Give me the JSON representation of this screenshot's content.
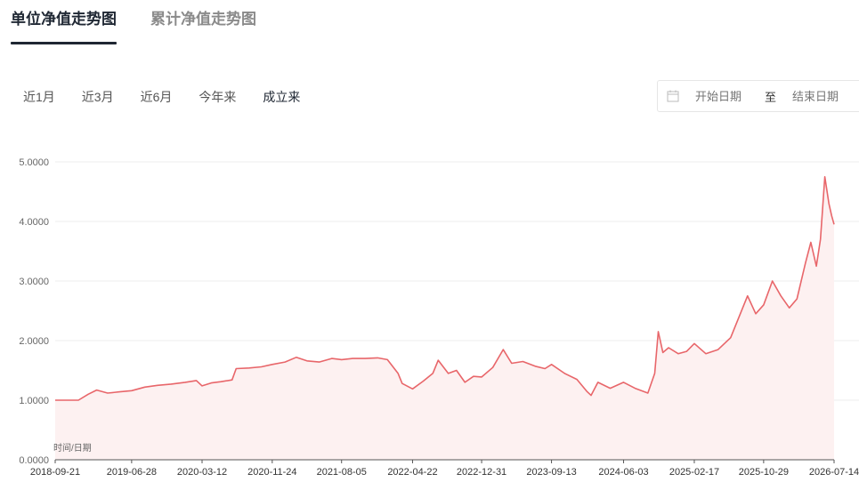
{
  "tabs": {
    "unit_nav": "单位净值走势图",
    "cumulative_nav": "累计净值走势图"
  },
  "ranges": [
    "近1月",
    "近3月",
    "近6月",
    "今年来",
    "成立来"
  ],
  "active_range_index": 4,
  "date_range": {
    "start_placeholder": "开始日期",
    "separator": "至",
    "end_placeholder": "结束日期"
  },
  "colors": {
    "line": "#e8666a",
    "area": "#fdf1f1",
    "tab_active": "#1f2733"
  },
  "chart_data": {
    "type": "area",
    "xlabel": "时间/日期",
    "ylabel": "",
    "ylim": [
      0,
      5
    ],
    "yticks": [
      "0.0000",
      "1.0000",
      "2.0000",
      "3.0000",
      "4.0000",
      "5.0000"
    ],
    "xticks": [
      "2018-09-21",
      "2019-06-28",
      "2020-03-12",
      "2020-11-24",
      "2021-08-05",
      "2022-04-22",
      "2022-12-31",
      "2023-09-13",
      "2024-06-03",
      "2025-02-17",
      "2025-10-29",
      "2026-07-14"
    ],
    "grid": true,
    "series": [
      {
        "name": "",
        "x": [
          "2018-09-21",
          "2018-12-15",
          "2019-01-20",
          "2019-02-20",
          "2019-04-01",
          "2019-05-15",
          "2019-06-28",
          "2019-08-15",
          "2019-10-01",
          "2019-11-20",
          "2020-01-10",
          "2020-02-20",
          "2020-03-12",
          "2020-04-15",
          "2020-05-20",
          "2020-06-30",
          "2020-07-15",
          "2020-08-31",
          "2020-10-15",
          "2020-11-24",
          "2021-01-10",
          "2021-02-20",
          "2021-03-31",
          "2021-05-15",
          "2021-06-30",
          "2021-08-05",
          "2021-09-15",
          "2021-10-31",
          "2021-12-15",
          "2022-01-20",
          "2022-02-28",
          "2022-03-15",
          "2022-04-22",
          "2022-05-31",
          "2022-07-05",
          "2022-07-25",
          "2022-08-31",
          "2022-09-30",
          "2022-10-31",
          "2022-12-01",
          "2022-12-31",
          "2023-02-10",
          "2023-03-20",
          "2023-04-20",
          "2023-05-31",
          "2023-07-15",
          "2023-08-20",
          "2023-09-13",
          "2023-10-31",
          "2023-12-15",
          "2024-01-20",
          "2024-02-05",
          "2024-03-01",
          "2024-04-15",
          "2024-06-03",
          "2024-07-15",
          "2024-08-31",
          "2024-09-25",
          "2024-10-08",
          "2024-10-25",
          "2024-11-15",
          "2024-12-20",
          "2025-01-20",
          "2025-02-17",
          "2025-03-31",
          "2025-05-15",
          "2025-06-30",
          "2025-07-31",
          "2025-08-31",
          "2025-09-30",
          "2025-10-29",
          "2025-11-30",
          "2025-12-31",
          "2026-01-31",
          "2026-02-28",
          "2026-03-31",
          "2026-04-20",
          "2026-05-10",
          "2026-05-25",
          "2026-06-10",
          "2026-06-25",
          "2026-07-05",
          "2026-07-14"
        ],
        "values": [
          1.0,
          1.0,
          1.1,
          1.17,
          1.12,
          1.14,
          1.16,
          1.22,
          1.25,
          1.27,
          1.3,
          1.33,
          1.24,
          1.29,
          1.31,
          1.34,
          1.53,
          1.54,
          1.56,
          1.6,
          1.64,
          1.72,
          1.66,
          1.64,
          1.7,
          1.68,
          1.7,
          1.7,
          1.71,
          1.68,
          1.45,
          1.28,
          1.19,
          1.32,
          1.45,
          1.67,
          1.45,
          1.5,
          1.3,
          1.4,
          1.39,
          1.55,
          1.85,
          1.62,
          1.65,
          1.57,
          1.53,
          1.6,
          1.45,
          1.35,
          1.15,
          1.08,
          1.3,
          1.2,
          1.3,
          1.2,
          1.12,
          1.45,
          2.15,
          1.8,
          1.88,
          1.78,
          1.82,
          1.95,
          1.78,
          1.85,
          2.05,
          2.4,
          2.75,
          2.45,
          2.6,
          3.0,
          2.75,
          2.55,
          2.7,
          3.3,
          3.65,
          3.25,
          3.7,
          4.75,
          4.3,
          4.1,
          3.95
        ]
      }
    ]
  }
}
